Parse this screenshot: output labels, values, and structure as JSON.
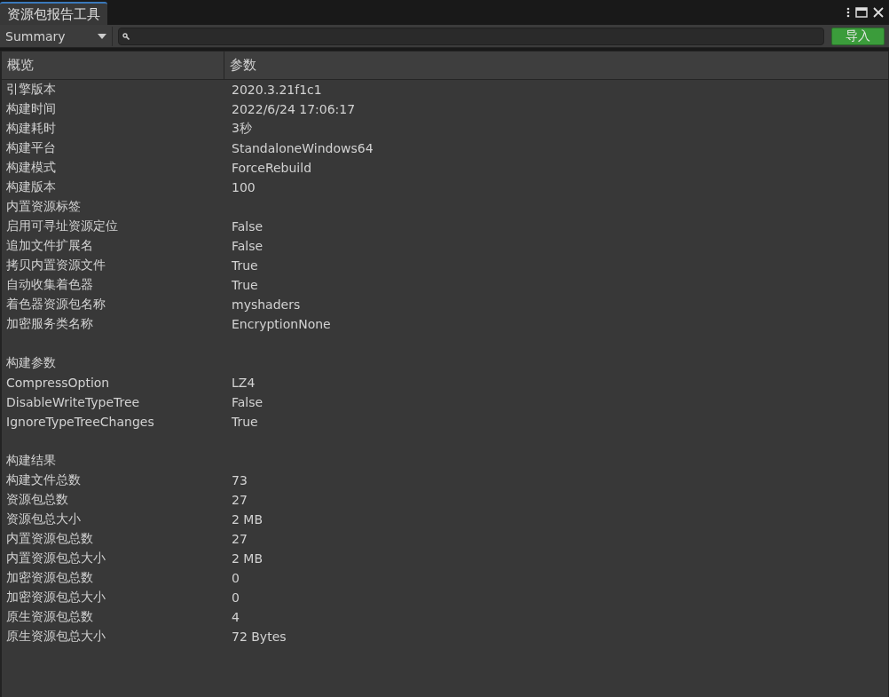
{
  "window": {
    "tab_title": "资源包报告工具"
  },
  "toolbar": {
    "view_dropdown": "Summary",
    "import_button": "导入"
  },
  "table": {
    "columns": [
      "概览",
      "参数"
    ],
    "sections": [
      {
        "rows": [
          {
            "label": "引擎版本",
            "value": "2020.3.21f1c1"
          },
          {
            "label": "构建时间",
            "value": "2022/6/24 17:06:17"
          },
          {
            "label": "构建耗时",
            "value": "3秒"
          },
          {
            "label": "构建平台",
            "value": "StandaloneWindows64"
          },
          {
            "label": "构建模式",
            "value": "ForceRebuild"
          },
          {
            "label": "构建版本",
            "value": "100"
          },
          {
            "label": "内置资源标签"
          },
          {
            "label": "启用可寻址资源定位",
            "value": "False"
          },
          {
            "label": "追加文件扩展名",
            "value": "False"
          },
          {
            "label": "拷贝内置资源文件",
            "value": "True"
          },
          {
            "label": "自动收集着色器",
            "value": "True"
          },
          {
            "label": "着色器资源包名称",
            "value": "myshaders"
          },
          {
            "label": "加密服务类名称",
            "value": "EncryptionNone"
          }
        ]
      },
      {
        "heading": "构建参数",
        "rows": [
          {
            "label": "CompressOption",
            "value": "LZ4"
          },
          {
            "label": "DisableWriteTypeTree",
            "value": "False"
          },
          {
            "label": "IgnoreTypeTreeChanges",
            "value": "True"
          }
        ]
      },
      {
        "heading": "构建结果",
        "rows": [
          {
            "label": "构建文件总数",
            "value": "73"
          },
          {
            "label": "资源包总数",
            "value": "27"
          },
          {
            "label": "资源包总大小",
            "value": "2 MB"
          },
          {
            "label": "内置资源包总数",
            "value": "27"
          },
          {
            "label": "内置资源包总大小",
            "value": "2 MB"
          },
          {
            "label": "加密资源包总数",
            "value": "0"
          },
          {
            "label": "加密资源包总大小",
            "value": "0"
          },
          {
            "label": "原生资源包总数",
            "value": "4"
          },
          {
            "label": "原生资源包总大小",
            "value": "72 Bytes"
          }
        ]
      }
    ]
  }
}
